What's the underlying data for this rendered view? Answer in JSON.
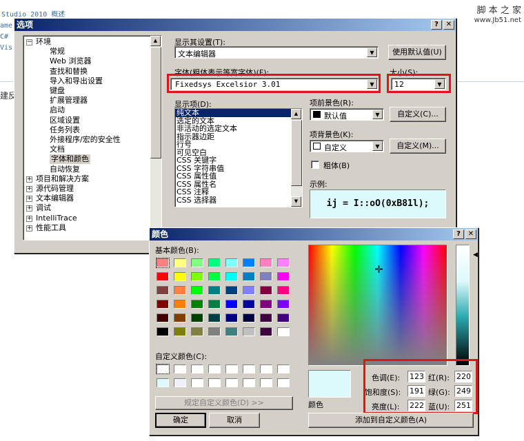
{
  "background": {
    "lines": [
      "Studio 2010 概述",
      "ame",
      "C#",
      "Vis"
    ],
    "lower_text": "建反",
    "watermark_title": "脚 本 之 家",
    "watermark_url": "www.Jb51.net"
  },
  "options_dialog": {
    "title": "选项",
    "tree": [
      {
        "label": "环境",
        "expanded": true
      },
      {
        "label": "常规"
      },
      {
        "label": "Web 浏览器"
      },
      {
        "label": "查找和替换"
      },
      {
        "label": "导入和导出设置"
      },
      {
        "label": "键盘"
      },
      {
        "label": "扩展管理器"
      },
      {
        "label": "启动"
      },
      {
        "label": "区域设置"
      },
      {
        "label": "任务列表"
      },
      {
        "label": "外接程序/宏的安全性"
      },
      {
        "label": "文档"
      },
      {
        "label": "字体和颜色",
        "selected": true
      },
      {
        "label": "自动恢复"
      },
      {
        "label": "项目和解决方案"
      },
      {
        "label": "源代码管理"
      },
      {
        "label": "文本编辑器"
      },
      {
        "label": "调试"
      },
      {
        "label": "IntelliTrace"
      },
      {
        "label": "性能工具"
      }
    ],
    "show_settings_for_label": "显示其设置(T):",
    "show_settings_for_value": "文本编辑器",
    "use_defaults_button": "使用默认值(U)",
    "font_label": "字体(粗体表示等宽字体)(F):",
    "font_value": "Fixedsys Excelsior 3.01",
    "size_label": "大小(S):",
    "size_value": "12",
    "display_items_label": "显示项(D):",
    "display_items": [
      "纯文本",
      "选定的文本",
      "非活动的选定文本",
      "指示器边距",
      "行号",
      "可见空白",
      "CSS 关键字",
      "CSS 字符串值",
      "CSS 属性值",
      "CSS 属性名",
      "CSS 注释",
      "CSS 选择器"
    ],
    "foreground_label": "项前景色(R):",
    "foreground_value": "默认值",
    "foreground_custom_button": "自定义(C)...",
    "background_label": "项背景色(K):",
    "background_value": "自定义",
    "background_custom_button": "自定义(M)...",
    "bold_label": "粗体(B)",
    "sample_label": "示例:",
    "sample_text": "ij = I::oO(0xB81l);"
  },
  "color_dialog": {
    "title": "颜色",
    "basic_colors_label": "基本颜色(B):",
    "basic_colors": [
      "#ff8080",
      "#ffff80",
      "#80ff80",
      "#00ff80",
      "#80ffff",
      "#0080ff",
      "#ff80c0",
      "#ff80ff",
      "#ff0000",
      "#ffff00",
      "#80ff00",
      "#00ff40",
      "#00ffff",
      "#0080c0",
      "#8080c0",
      "#ff00ff",
      "#804040",
      "#ff8040",
      "#00ff00",
      "#008080",
      "#004080",
      "#8080ff",
      "#800040",
      "#ff0080",
      "#800000",
      "#ff8000",
      "#008000",
      "#008040",
      "#0000ff",
      "#0000a0",
      "#800080",
      "#8000ff",
      "#400000",
      "#804000",
      "#004000",
      "#004040",
      "#000080",
      "#000040",
      "#400040",
      "#400080",
      "#000000",
      "#808000",
      "#808040",
      "#808080",
      "#408080",
      "#c0c0c0",
      "#400040",
      "#ffffff"
    ],
    "custom_colors_label": "自定义颜色(C):",
    "custom_colors": [
      "#ffffff",
      "#ffffff",
      "#ffffff",
      "#ffffff",
      "#ffffff",
      "#ffffff",
      "#ffffff",
      "#ffffff",
      "#dcf9fb",
      "#f0f0f8",
      "#ffffff",
      "#ffffff",
      "#ffffff",
      "#ffffff",
      "#ffffff",
      "#ffffff"
    ],
    "define_custom_button": "规定自定义颜色(D) >>",
    "ok_button": "确定",
    "cancel_button": "取消",
    "color_solid_label": "颜色",
    "hue_label": "色调(E):",
    "hue_value": "123",
    "sat_label": "饱和度(S):",
    "sat_value": "191",
    "lum_label": "亮度(L):",
    "lum_value": "222",
    "red_label": "红(R):",
    "red_value": "220",
    "green_label": "绿(G):",
    "green_value": "249",
    "blue_label": "蓝(U):",
    "blue_value": "251",
    "add_custom_button": "添加到自定义颜色(A)",
    "preview_color": "#dcf9fb"
  },
  "colors": {
    "highlight": "#e0141c",
    "title_gradient_start": "#0a246a",
    "selection": "#0a246a"
  }
}
